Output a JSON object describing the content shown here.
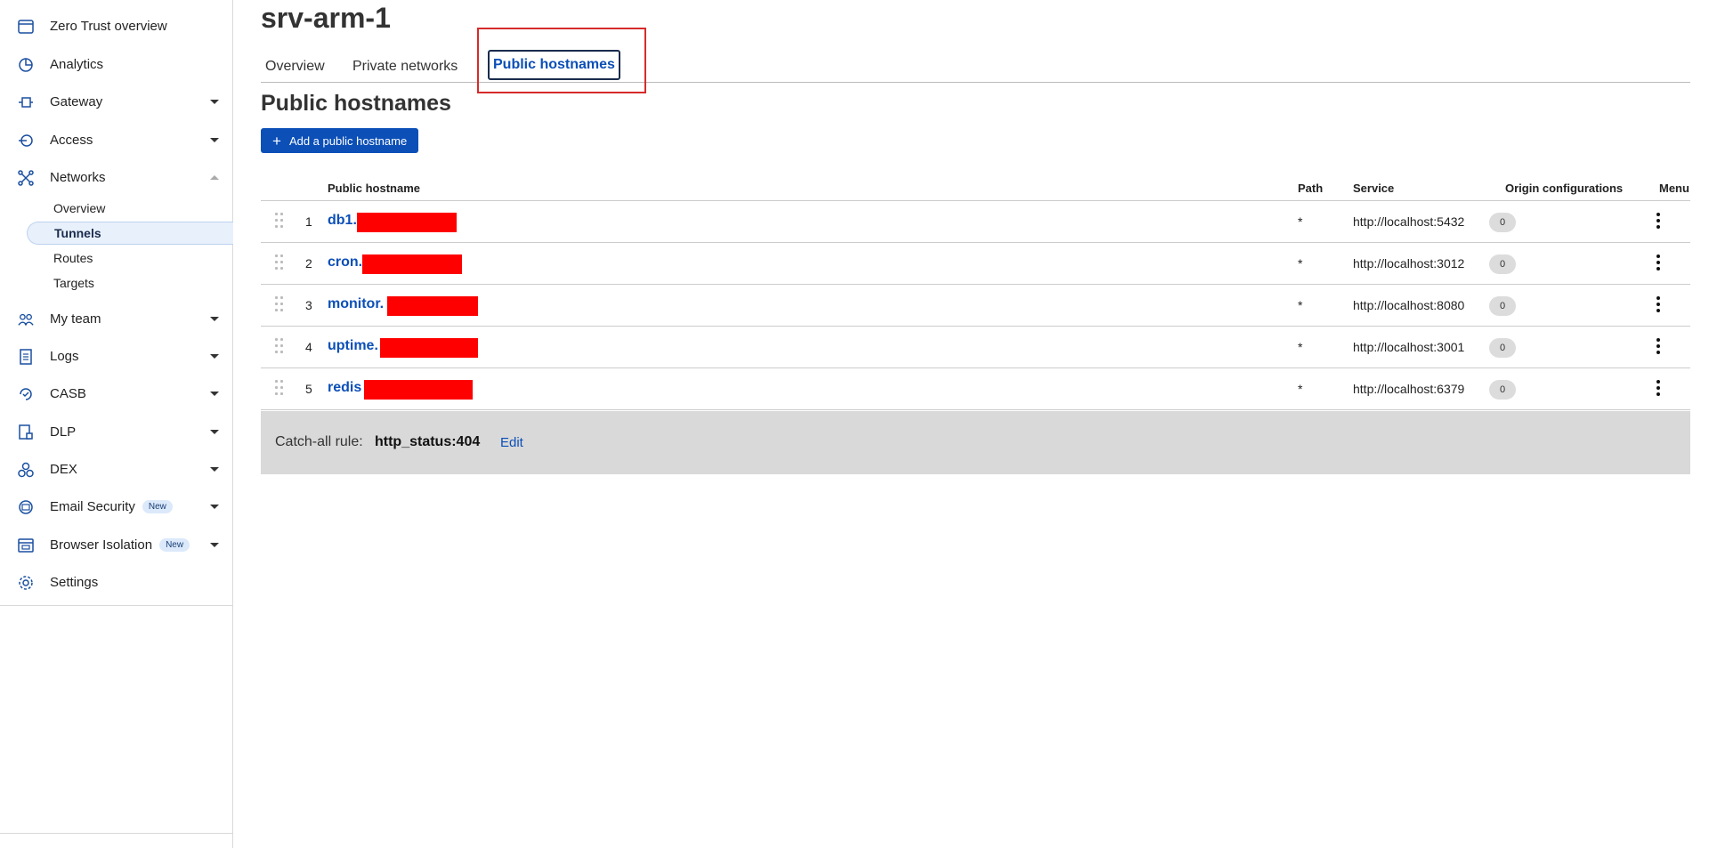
{
  "sidebar": {
    "items": [
      {
        "label": "Zero Trust overview",
        "icon": "browser-window-icon",
        "caret": false
      },
      {
        "label": "Analytics",
        "icon": "pie-chart-icon",
        "caret": false
      },
      {
        "label": "Gateway",
        "icon": "gateway-icon",
        "caret": true
      },
      {
        "label": "Access",
        "icon": "access-icon",
        "caret": true
      },
      {
        "label": "Networks",
        "icon": "networks-icon",
        "caret": "up"
      },
      {
        "label": "My team",
        "icon": "team-icon",
        "caret": true
      },
      {
        "label": "Logs",
        "icon": "logs-icon",
        "caret": true
      },
      {
        "label": "CASB",
        "icon": "casb-icon",
        "caret": true
      },
      {
        "label": "DLP",
        "icon": "dlp-icon",
        "caret": true
      },
      {
        "label": "DEX",
        "icon": "dex-icon",
        "caret": true
      },
      {
        "label": "Email Security",
        "icon": "email-security-icon",
        "caret": true,
        "badge": "New"
      },
      {
        "label": "Browser Isolation",
        "icon": "browser-isolation-icon",
        "caret": true,
        "badge": "New"
      },
      {
        "label": "Settings",
        "icon": "gear-icon",
        "caret": false
      }
    ],
    "networks_sub": [
      "Overview",
      "Tunnels",
      "Routes",
      "Targets"
    ],
    "active_sub": "Tunnels"
  },
  "page": {
    "title": "srv-arm-1",
    "tabs": [
      "Overview",
      "Private networks",
      "Public hostnames"
    ],
    "active_tab": "Public hostnames",
    "section_title": "Public hostnames",
    "add_button": "Add a public hostname"
  },
  "table": {
    "headers": {
      "hostname": "Public hostname",
      "path": "Path",
      "service": "Service",
      "origin": "Origin configurations",
      "menu": "Menu"
    },
    "rows": [
      {
        "num": "1",
        "host": "db1.",
        "path": "*",
        "service": "http://localhost:5432",
        "origin": "0"
      },
      {
        "num": "2",
        "host": "cron.",
        "path": "*",
        "service": "http://localhost:3012",
        "origin": "0"
      },
      {
        "num": "3",
        "host": "monitor.",
        "path": "*",
        "service": "http://localhost:8080",
        "origin": "0"
      },
      {
        "num": "4",
        "host": "uptime.",
        "path": "*",
        "service": "http://localhost:3001",
        "origin": "0"
      },
      {
        "num": "5",
        "host": "redis",
        "path": "*",
        "service": "http://localhost:6379",
        "origin": "0"
      }
    ]
  },
  "catchall": {
    "label": "Catch-all rule:",
    "value": "http_status:404",
    "edit": "Edit"
  },
  "colors": {
    "accent": "#0b4fb7",
    "redaction": "#ff0000",
    "highlight": "#d62b2b"
  }
}
